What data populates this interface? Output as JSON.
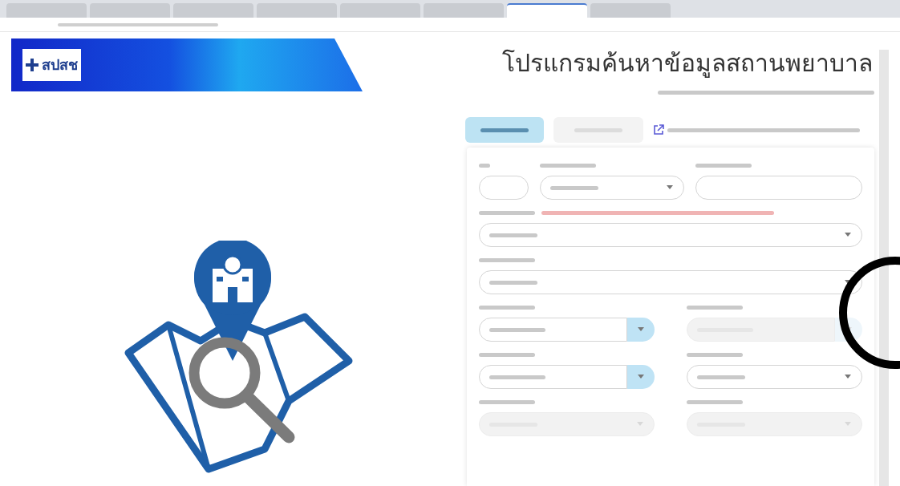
{
  "header": {
    "logo_text": "สปสช",
    "title": "โปรแกรมค้นหาข้อมูลสถานพยาบาล"
  },
  "browser_tabs": [
    {
      "selected": false
    },
    {
      "selected": false
    },
    {
      "selected": false
    },
    {
      "selected": false
    },
    {
      "selected": false
    },
    {
      "selected": false
    },
    {
      "selected": true
    },
    {
      "selected": false
    }
  ],
  "tabs": [
    {
      "selected": true
    },
    {
      "selected": false
    }
  ],
  "form": {
    "rows": [
      [
        {
          "kind": "short-input",
          "disabled": false
        },
        {
          "kind": "select",
          "disabled": false
        },
        {
          "kind": "input",
          "disabled": false
        }
      ],
      [
        {
          "kind": "select",
          "disabled": false,
          "note": true
        }
      ],
      [
        {
          "kind": "select",
          "disabled": false
        }
      ],
      [
        {
          "kind": "select-button",
          "disabled": false
        },
        {
          "kind": "select-button",
          "disabled": true
        }
      ],
      [
        {
          "kind": "select-button",
          "disabled": false
        },
        {
          "kind": "select",
          "disabled": false
        }
      ],
      [
        {
          "kind": "select",
          "disabled": true
        },
        {
          "kind": "select",
          "disabled": true
        }
      ]
    ]
  }
}
